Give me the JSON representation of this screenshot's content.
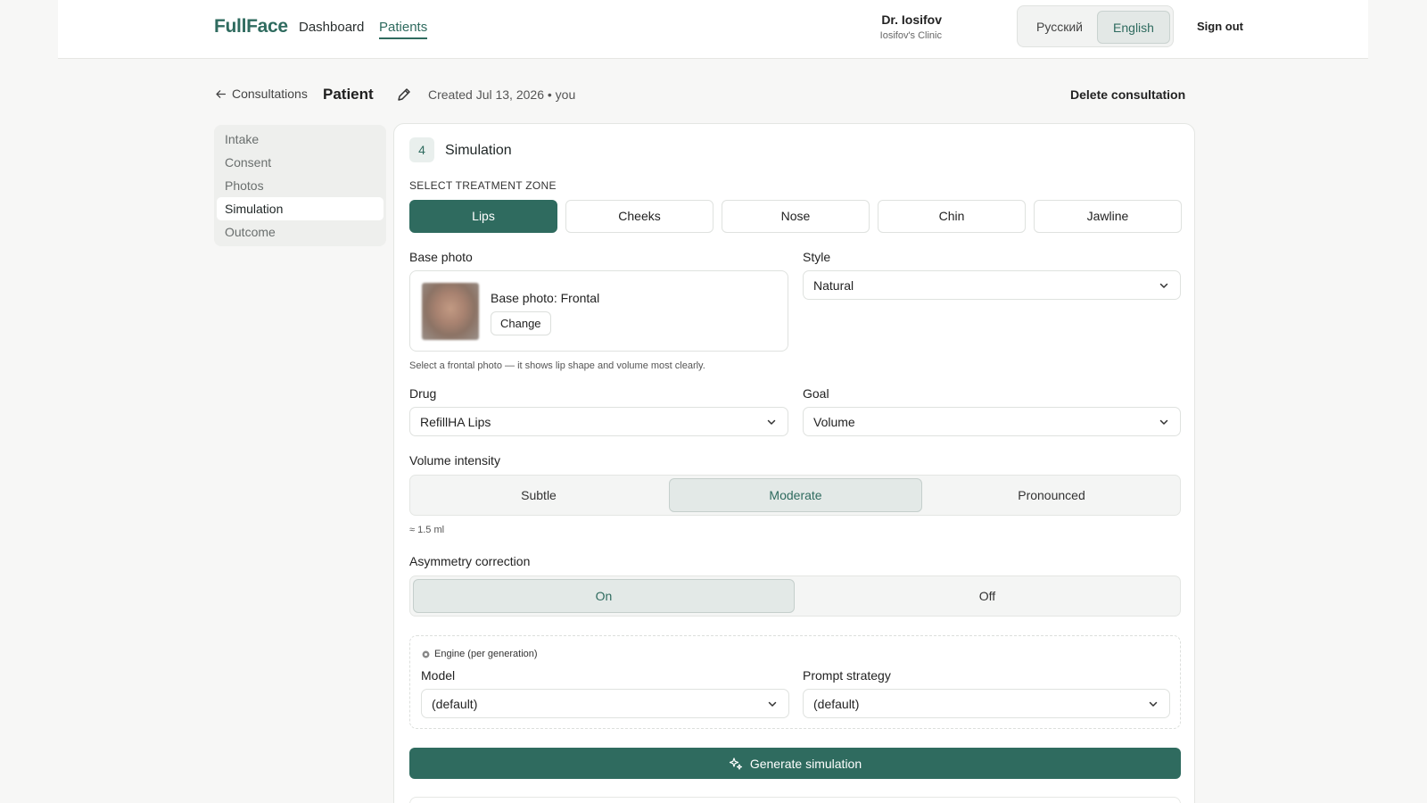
{
  "header": {
    "brand": "FullFace",
    "nav": [
      {
        "label": "Dashboard",
        "active": false
      },
      {
        "label": "Patients",
        "active": true
      }
    ],
    "user": {
      "name": "Dr. Iosifov",
      "clinic": "Iosifov's Clinic"
    },
    "languages": [
      {
        "label": "Русский",
        "active": false
      },
      {
        "label": "English",
        "active": true
      }
    ],
    "sign_out": "Sign out"
  },
  "page": {
    "back_label": "Consultations",
    "title": "Patient",
    "created": "Created Jul 13, 2026 • you",
    "delete_label": "Delete consultation"
  },
  "sidebar": {
    "items": [
      {
        "label": "Intake",
        "active": false
      },
      {
        "label": "Consent",
        "active": false
      },
      {
        "label": "Photos",
        "active": false
      },
      {
        "label": "Simulation",
        "active": true
      },
      {
        "label": "Outcome",
        "active": false
      }
    ]
  },
  "simulation": {
    "step_number": "4",
    "step_title": "Simulation",
    "zone_label": "SELECT TREATMENT ZONE",
    "zones": [
      {
        "label": "Lips",
        "active": true
      },
      {
        "label": "Cheeks",
        "active": false
      },
      {
        "label": "Nose",
        "active": false
      },
      {
        "label": "Chin",
        "active": false
      },
      {
        "label": "Jawline",
        "active": false
      }
    ],
    "base_photo_label": "Base photo",
    "base_photo_title": "Base photo: Frontal",
    "change_label": "Change",
    "photo_hint": "Select a frontal photo — it shows lip shape and volume most clearly.",
    "style_label": "Style",
    "style_value": "Natural",
    "drug_label": "Drug",
    "drug_value": "RefillHA Lips",
    "goal_label": "Goal",
    "goal_value": "Volume",
    "intensity_label": "Volume intensity",
    "intensity_options": [
      {
        "label": "Subtle",
        "active": false
      },
      {
        "label": "Moderate",
        "active": true
      },
      {
        "label": "Pronounced",
        "active": false
      }
    ],
    "intensity_note": "≈ 1.5 ml",
    "asymmetry_label": "Asymmetry correction",
    "asymmetry_options": [
      {
        "label": "On",
        "active": true
      },
      {
        "label": "Off",
        "active": false
      }
    ],
    "engine_title": "Engine (per generation)",
    "model_label": "Model",
    "model_value": "(default)",
    "prompt_label": "Prompt strategy",
    "prompt_value": "(default)",
    "generate_label": "Generate simulation"
  },
  "colors": {
    "accent": "#2f6b5f",
    "background": "#f7f7f6",
    "surface": "#ffffff"
  }
}
